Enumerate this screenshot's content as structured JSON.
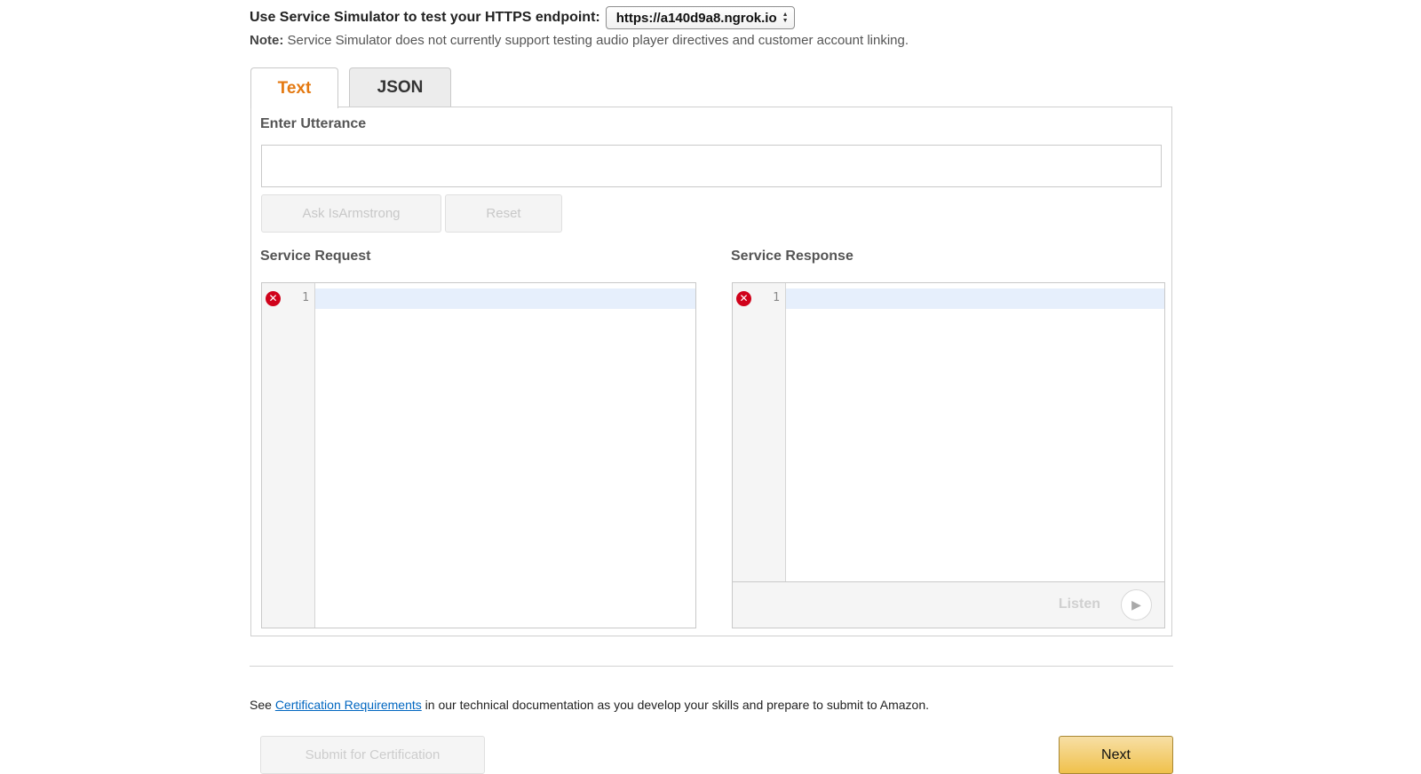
{
  "endpoint": {
    "label": "Use Service Simulator to test your HTTPS endpoint:",
    "selected": "https://a140d9a8.ngrok.io"
  },
  "note": {
    "prefix": "Note:",
    "text": " Service Simulator does not currently support testing audio player directives and customer account linking."
  },
  "tabs": [
    {
      "label": "Text",
      "active": true
    },
    {
      "label": "JSON",
      "active": false
    }
  ],
  "utterance": {
    "label": "Enter Utterance",
    "value": "",
    "ask_button": "Ask IsArmstrong",
    "reset_button": "Reset"
  },
  "request": {
    "label": "Service Request",
    "line_number": "1",
    "error_icon": "✕"
  },
  "response": {
    "label": "Service Response",
    "line_number": "1",
    "error_icon": "✕",
    "listen_label": "Listen",
    "play_icon": "▶"
  },
  "certification": {
    "prefix": "See ",
    "link": "Certification Requirements",
    "suffix": " in our technical documentation as you develop your skills and prepare to submit to Amazon."
  },
  "footer": {
    "submit_button": "Submit for Certification",
    "next_button": "Next"
  }
}
